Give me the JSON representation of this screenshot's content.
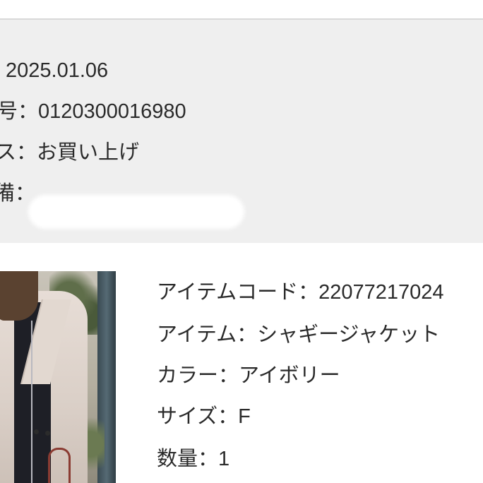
{
  "order": {
    "date": "2025.01.06",
    "number_label_fragment": "号：",
    "number": "0120300016980",
    "status_label_fragment": "ス：",
    "status": "お買い上げ",
    "note_label_fragment": "備：",
    "note_redacted": true
  },
  "item": {
    "code_label": "アイテムコード：",
    "code": "22077217024",
    "name_label": "アイテム：",
    "name": "シャギージャケット",
    "color_label": "カラー：",
    "color": "アイボリー",
    "size_label": "サイズ：",
    "size": "F",
    "qty_label": "数量：",
    "qty": "1"
  },
  "colors": {
    "panel": "#efefef",
    "text": "#2a2a2a",
    "divider": "#d9d9d9"
  }
}
